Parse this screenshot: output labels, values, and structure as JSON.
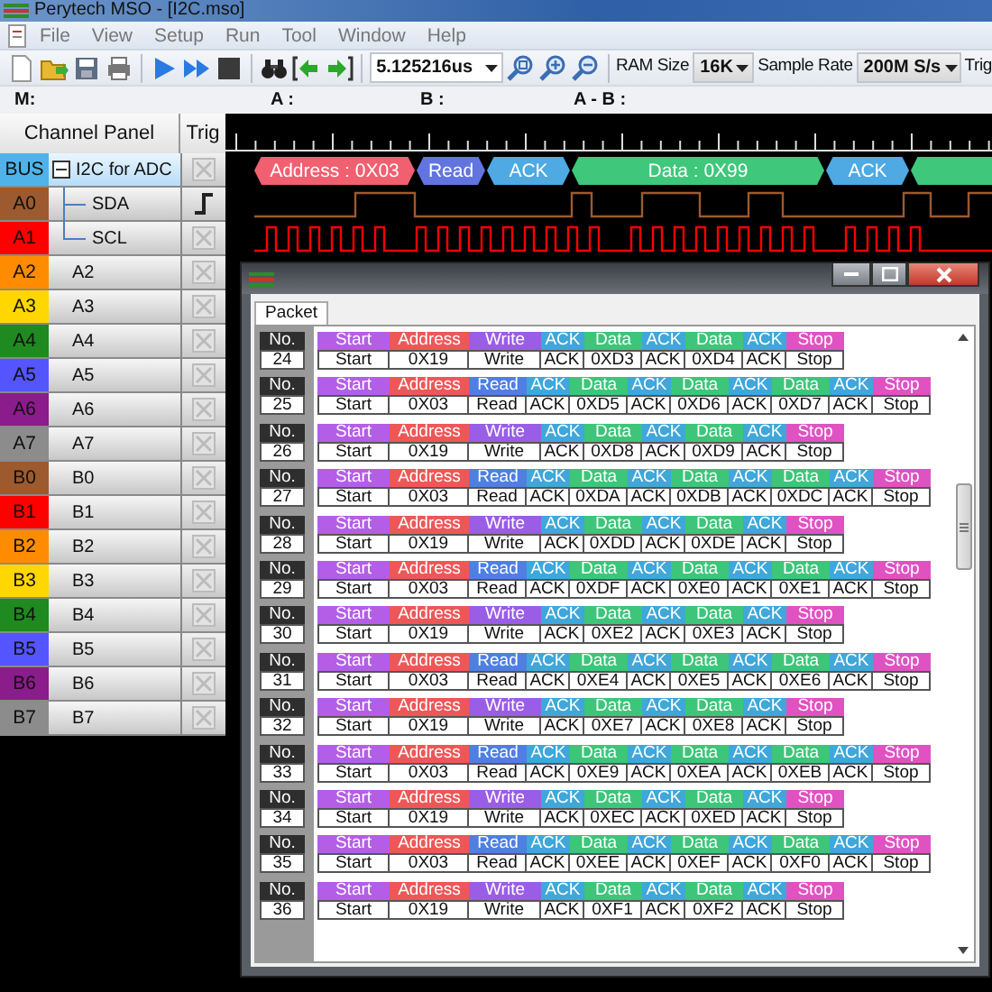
{
  "window": {
    "title": "Perytech MSO - [I2C.mso]"
  },
  "menu": [
    "File",
    "View",
    "Setup",
    "Run",
    "Tool",
    "Window",
    "Help"
  ],
  "toolbar": {
    "time": "5.125216us",
    "ram_label": "RAM Size",
    "ram": "16K",
    "rate_label": "Sample Rate",
    "rate": "200M S/s",
    "trig_label": "Trig"
  },
  "cursors": [
    "M:",
    "A :",
    "B :",
    "A - B :"
  ],
  "channel_panel": {
    "title": "Channel Panel",
    "trig_title": "Trig"
  },
  "channels": [
    {
      "tag": "BUS",
      "name": "I2C for ADC",
      "kind": "bus",
      "color": "#4fb3ea",
      "selected": true,
      "trigger": false
    },
    {
      "tag": "A0",
      "name": "SDA",
      "kind": "sub",
      "color": "#9c5a2e",
      "selected": false,
      "trigger": true
    },
    {
      "tag": "A1",
      "name": "SCL",
      "kind": "sub",
      "color": "#ff0000",
      "selected": false,
      "trigger": false
    },
    {
      "tag": "A2",
      "name": "A2",
      "kind": "plain",
      "color": "#ff8c00",
      "selected": false,
      "trigger": false
    },
    {
      "tag": "A3",
      "name": "A3",
      "kind": "plain",
      "color": "#ffd700",
      "selected": false,
      "trigger": false
    },
    {
      "tag": "A4",
      "name": "A4",
      "kind": "plain",
      "color": "#1f8a1f",
      "selected": false,
      "trigger": false
    },
    {
      "tag": "A5",
      "name": "A5",
      "kind": "plain",
      "color": "#5555ff",
      "selected": false,
      "trigger": false
    },
    {
      "tag": "A6",
      "name": "A6",
      "kind": "plain",
      "color": "#8b1c8b",
      "selected": false,
      "trigger": false
    },
    {
      "tag": "A7",
      "name": "A7",
      "kind": "plain",
      "color": "#8c8c8c",
      "selected": false,
      "trigger": false
    },
    {
      "tag": "B0",
      "name": "B0",
      "kind": "plain",
      "color": "#9c5a2e",
      "selected": false,
      "trigger": false
    },
    {
      "tag": "B1",
      "name": "B1",
      "kind": "plain",
      "color": "#ff0000",
      "selected": false,
      "trigger": false
    },
    {
      "tag": "B2",
      "name": "B2",
      "kind": "plain",
      "color": "#ff8c00",
      "selected": false,
      "trigger": false
    },
    {
      "tag": "B3",
      "name": "B3",
      "kind": "plain",
      "color": "#ffd700",
      "selected": false,
      "trigger": false
    },
    {
      "tag": "B4",
      "name": "B4",
      "kind": "plain",
      "color": "#1f8a1f",
      "selected": false,
      "trigger": false
    },
    {
      "tag": "B5",
      "name": "B5",
      "kind": "plain",
      "color": "#5555ff",
      "selected": false,
      "trigger": false
    },
    {
      "tag": "B6",
      "name": "B6",
      "kind": "plain",
      "color": "#8b1c8b",
      "selected": false,
      "trigger": false
    },
    {
      "tag": "B7",
      "name": "B7",
      "kind": "plain",
      "color": "#8c8c8c",
      "selected": false,
      "trigger": false
    }
  ],
  "bus_decode": [
    {
      "kind": "address",
      "label": "Address : 0X03"
    },
    {
      "kind": "read",
      "label": "Read"
    },
    {
      "kind": "ack",
      "label": "ACK"
    },
    {
      "kind": "data",
      "label": "Data : 0X99"
    },
    {
      "kind": "ack",
      "label": "ACK"
    },
    {
      "kind": "data"
    }
  ],
  "packet_window": {
    "tabs": [
      {
        "label": "Packet",
        "selected": true
      }
    ],
    "packets": [
      {
        "no_label": "No.",
        "no": "24",
        "fields": [
          {
            "kind": "start",
            "label": "Start",
            "value": "Start"
          },
          {
            "kind": "address",
            "label": "Address",
            "value": "0X19"
          },
          {
            "kind": "write",
            "label": "Write",
            "value": "Write"
          },
          {
            "kind": "ack",
            "label": "ACK",
            "value": "ACK"
          },
          {
            "kind": "data",
            "label": "Data",
            "value": "0XD3"
          },
          {
            "kind": "ack",
            "label": "ACK",
            "value": "ACK"
          },
          {
            "kind": "data",
            "label": "Data",
            "value": "0XD4"
          },
          {
            "kind": "ack",
            "label": "ACK",
            "value": "ACK"
          },
          {
            "kind": "stop",
            "label": "Stop",
            "value": "Stop"
          }
        ]
      },
      {
        "no_label": "No.",
        "no": "25",
        "fields": [
          {
            "kind": "start",
            "label": "Start",
            "value": "Start"
          },
          {
            "kind": "address",
            "label": "Address",
            "value": "0X03"
          },
          {
            "kind": "read",
            "label": "Read",
            "value": "Read"
          },
          {
            "kind": "ack",
            "label": "ACK",
            "value": "ACK"
          },
          {
            "kind": "data",
            "label": "Data",
            "value": "0XD5"
          },
          {
            "kind": "ack",
            "label": "ACK",
            "value": "ACK"
          },
          {
            "kind": "data",
            "label": "Data",
            "value": "0XD6"
          },
          {
            "kind": "ack",
            "label": "ACK",
            "value": "ACK"
          },
          {
            "kind": "data",
            "label": "Data",
            "value": "0XD7"
          },
          {
            "kind": "ack",
            "label": "ACK",
            "value": "ACK"
          },
          {
            "kind": "stop",
            "label": "Stop",
            "value": "Stop"
          }
        ]
      },
      {
        "no_label": "No.",
        "no": "26",
        "fields": [
          {
            "kind": "start",
            "label": "Start",
            "value": "Start"
          },
          {
            "kind": "address",
            "label": "Address",
            "value": "0X19"
          },
          {
            "kind": "write",
            "label": "Write",
            "value": "Write"
          },
          {
            "kind": "ack",
            "label": "ACK",
            "value": "ACK"
          },
          {
            "kind": "data",
            "label": "Data",
            "value": "0XD8"
          },
          {
            "kind": "ack",
            "label": "ACK",
            "value": "ACK"
          },
          {
            "kind": "data",
            "label": "Data",
            "value": "0XD9"
          },
          {
            "kind": "ack",
            "label": "ACK",
            "value": "ACK"
          },
          {
            "kind": "stop",
            "label": "Stop",
            "value": "Stop"
          }
        ]
      },
      {
        "no_label": "No.",
        "no": "27",
        "fields": [
          {
            "kind": "start",
            "label": "Start",
            "value": "Start"
          },
          {
            "kind": "address",
            "label": "Address",
            "value": "0X03"
          },
          {
            "kind": "read",
            "label": "Read",
            "value": "Read"
          },
          {
            "kind": "ack",
            "label": "ACK",
            "value": "ACK"
          },
          {
            "kind": "data",
            "label": "Data",
            "value": "0XDA"
          },
          {
            "kind": "ack",
            "label": "ACK",
            "value": "ACK"
          },
          {
            "kind": "data",
            "label": "Data",
            "value": "0XDB"
          },
          {
            "kind": "ack",
            "label": "ACK",
            "value": "ACK"
          },
          {
            "kind": "data",
            "label": "Data",
            "value": "0XDC"
          },
          {
            "kind": "ack",
            "label": "ACK",
            "value": "ACK"
          },
          {
            "kind": "stop",
            "label": "Stop",
            "value": "Stop"
          }
        ]
      },
      {
        "no_label": "No.",
        "no": "28",
        "fields": [
          {
            "kind": "start",
            "label": "Start",
            "value": "Start"
          },
          {
            "kind": "address",
            "label": "Address",
            "value": "0X19"
          },
          {
            "kind": "write",
            "label": "Write",
            "value": "Write"
          },
          {
            "kind": "ack",
            "label": "ACK",
            "value": "ACK"
          },
          {
            "kind": "data",
            "label": "Data",
            "value": "0XDD"
          },
          {
            "kind": "ack",
            "label": "ACK",
            "value": "ACK"
          },
          {
            "kind": "data",
            "label": "Data",
            "value": "0XDE"
          },
          {
            "kind": "ack",
            "label": "ACK",
            "value": "ACK"
          },
          {
            "kind": "stop",
            "label": "Stop",
            "value": "Stop"
          }
        ]
      },
      {
        "no_label": "No.",
        "no": "29",
        "fields": [
          {
            "kind": "start",
            "label": "Start",
            "value": "Start"
          },
          {
            "kind": "address",
            "label": "Address",
            "value": "0X03"
          },
          {
            "kind": "read",
            "label": "Read",
            "value": "Read"
          },
          {
            "kind": "ack",
            "label": "ACK",
            "value": "ACK"
          },
          {
            "kind": "data",
            "label": "Data",
            "value": "0XDF"
          },
          {
            "kind": "ack",
            "label": "ACK",
            "value": "ACK"
          },
          {
            "kind": "data",
            "label": "Data",
            "value": "0XE0"
          },
          {
            "kind": "ack",
            "label": "ACK",
            "value": "ACK"
          },
          {
            "kind": "data",
            "label": "Data",
            "value": "0XE1"
          },
          {
            "kind": "ack",
            "label": "ACK",
            "value": "ACK"
          },
          {
            "kind": "stop",
            "label": "Stop",
            "value": "Stop"
          }
        ]
      },
      {
        "no_label": "No.",
        "no": "30",
        "fields": [
          {
            "kind": "start",
            "label": "Start",
            "value": "Start"
          },
          {
            "kind": "address",
            "label": "Address",
            "value": "0X19"
          },
          {
            "kind": "write",
            "label": "Write",
            "value": "Write"
          },
          {
            "kind": "ack",
            "label": "ACK",
            "value": "ACK"
          },
          {
            "kind": "data",
            "label": "Data",
            "value": "0XE2"
          },
          {
            "kind": "ack",
            "label": "ACK",
            "value": "ACK"
          },
          {
            "kind": "data",
            "label": "Data",
            "value": "0XE3"
          },
          {
            "kind": "ack",
            "label": "ACK",
            "value": "ACK"
          },
          {
            "kind": "stop",
            "label": "Stop",
            "value": "Stop"
          }
        ]
      },
      {
        "no_label": "No.",
        "no": "31",
        "fields": [
          {
            "kind": "start",
            "label": "Start",
            "value": "Start"
          },
          {
            "kind": "address",
            "label": "Address",
            "value": "0X03"
          },
          {
            "kind": "read",
            "label": "Read",
            "value": "Read"
          },
          {
            "kind": "ack",
            "label": "ACK",
            "value": "ACK"
          },
          {
            "kind": "data",
            "label": "Data",
            "value": "0XE4"
          },
          {
            "kind": "ack",
            "label": "ACK",
            "value": "ACK"
          },
          {
            "kind": "data",
            "label": "Data",
            "value": "0XE5"
          },
          {
            "kind": "ack",
            "label": "ACK",
            "value": "ACK"
          },
          {
            "kind": "data",
            "label": "Data",
            "value": "0XE6"
          },
          {
            "kind": "ack",
            "label": "ACK",
            "value": "ACK"
          },
          {
            "kind": "stop",
            "label": "Stop",
            "value": "Stop"
          }
        ]
      },
      {
        "no_label": "No.",
        "no": "32",
        "fields": [
          {
            "kind": "start",
            "label": "Start",
            "value": "Start"
          },
          {
            "kind": "address",
            "label": "Address",
            "value": "0X19"
          },
          {
            "kind": "write",
            "label": "Write",
            "value": "Write"
          },
          {
            "kind": "ack",
            "label": "ACK",
            "value": "ACK"
          },
          {
            "kind": "data",
            "label": "Data",
            "value": "0XE7"
          },
          {
            "kind": "ack",
            "label": "ACK",
            "value": "ACK"
          },
          {
            "kind": "data",
            "label": "Data",
            "value": "0XE8"
          },
          {
            "kind": "ack",
            "label": "ACK",
            "value": "ACK"
          },
          {
            "kind": "stop",
            "label": "Stop",
            "value": "Stop"
          }
        ]
      },
      {
        "no_label": "No.",
        "no": "33",
        "fields": [
          {
            "kind": "start",
            "label": "Start",
            "value": "Start"
          },
          {
            "kind": "address",
            "label": "Address",
            "value": "0X03"
          },
          {
            "kind": "read",
            "label": "Read",
            "value": "Read"
          },
          {
            "kind": "ack",
            "label": "ACK",
            "value": "ACK"
          },
          {
            "kind": "data",
            "label": "Data",
            "value": "0XE9"
          },
          {
            "kind": "ack",
            "label": "ACK",
            "value": "ACK"
          },
          {
            "kind": "data",
            "label": "Data",
            "value": "0XEA"
          },
          {
            "kind": "ack",
            "label": "ACK",
            "value": "ACK"
          },
          {
            "kind": "data",
            "label": "Data",
            "value": "0XEB"
          },
          {
            "kind": "ack",
            "label": "ACK",
            "value": "ACK"
          },
          {
            "kind": "stop",
            "label": "Stop",
            "value": "Stop"
          }
        ]
      },
      {
        "no_label": "No.",
        "no": "34",
        "fields": [
          {
            "kind": "start",
            "label": "Start",
            "value": "Start"
          },
          {
            "kind": "address",
            "label": "Address",
            "value": "0X19"
          },
          {
            "kind": "write",
            "label": "Write",
            "value": "Write"
          },
          {
            "kind": "ack",
            "label": "ACK",
            "value": "ACK"
          },
          {
            "kind": "data",
            "label": "Data",
            "value": "0XEC"
          },
          {
            "kind": "ack",
            "label": "ACK",
            "value": "ACK"
          },
          {
            "kind": "data",
            "label": "Data",
            "value": "0XED"
          },
          {
            "kind": "ack",
            "label": "ACK",
            "value": "ACK"
          },
          {
            "kind": "stop",
            "label": "Stop",
            "value": "Stop"
          }
        ]
      },
      {
        "no_label": "No.",
        "no": "35",
        "fields": [
          {
            "kind": "start",
            "label": "Start",
            "value": "Start"
          },
          {
            "kind": "address",
            "label": "Address",
            "value": "0X03"
          },
          {
            "kind": "read",
            "label": "Read",
            "value": "Read"
          },
          {
            "kind": "ack",
            "label": "ACK",
            "value": "ACK"
          },
          {
            "kind": "data",
            "label": "Data",
            "value": "0XEE"
          },
          {
            "kind": "ack",
            "label": "ACK",
            "value": "ACK"
          },
          {
            "kind": "data",
            "label": "Data",
            "value": "0XEF"
          },
          {
            "kind": "ack",
            "label": "ACK",
            "value": "ACK"
          },
          {
            "kind": "data",
            "label": "Data",
            "value": "0XF0"
          },
          {
            "kind": "ack",
            "label": "ACK",
            "value": "ACK"
          },
          {
            "kind": "stop",
            "label": "Stop",
            "value": "Stop"
          }
        ]
      },
      {
        "no_label": "No.",
        "no": "36",
        "fields": [
          {
            "kind": "start",
            "label": "Start",
            "value": "Start"
          },
          {
            "kind": "address",
            "label": "Address",
            "value": "0X19"
          },
          {
            "kind": "write",
            "label": "Write",
            "value": "Write"
          },
          {
            "kind": "ack",
            "label": "ACK",
            "value": "ACK"
          },
          {
            "kind": "data",
            "label": "Data",
            "value": "0XF1"
          },
          {
            "kind": "ack",
            "label": "ACK",
            "value": "ACK"
          },
          {
            "kind": "data",
            "label": "Data",
            "value": "0XF2"
          },
          {
            "kind": "ack",
            "label": "ACK",
            "value": "ACK"
          },
          {
            "kind": "stop",
            "label": "Stop",
            "value": "Stop"
          }
        ]
      }
    ]
  }
}
